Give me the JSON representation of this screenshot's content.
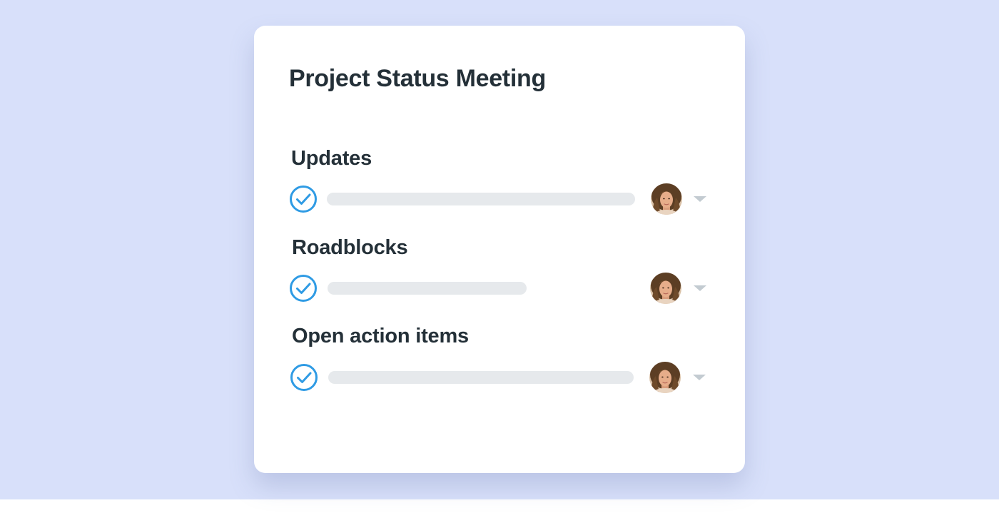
{
  "card": {
    "title": "Project Status Meeting"
  },
  "sections": [
    {
      "heading": "Updates",
      "task": {
        "completed": true,
        "fill": 0.98,
        "assignee": "avatar"
      }
    },
    {
      "heading": "Roadblocks",
      "task": {
        "completed": true,
        "fill": 0.63,
        "assignee": "avatar"
      }
    },
    {
      "heading": "Open action items",
      "task": {
        "completed": true,
        "fill": 0.97,
        "assignee": "avatar"
      }
    }
  ],
  "colors": {
    "background": "#d8e0fa",
    "card": "#ffffff",
    "text": "#243038",
    "check": "#2f9be4",
    "placeholder_bar": "#e6e9ec",
    "caret": "#c3cbd1"
  },
  "icons": {
    "check": "check-circle-icon",
    "caret": "caret-down-icon"
  }
}
